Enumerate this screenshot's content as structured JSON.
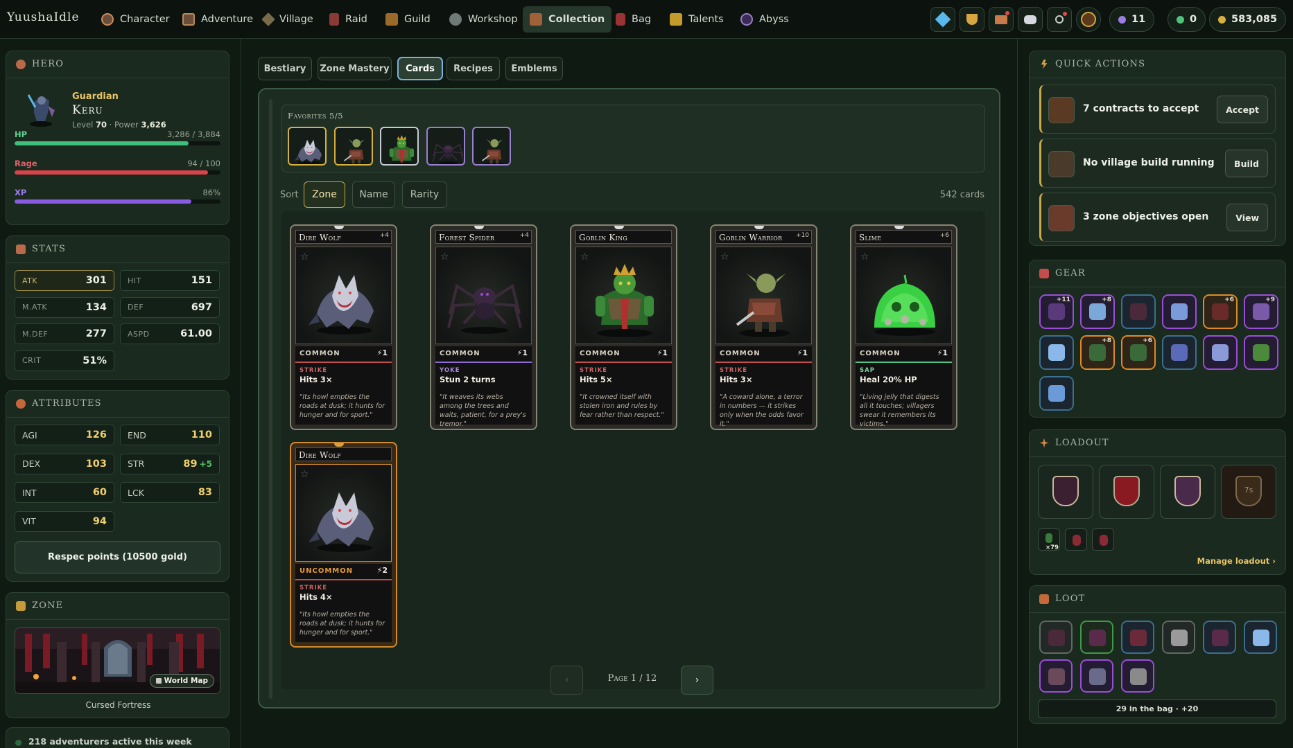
{
  "nav": {
    "logo": "YuushaIdle",
    "items": [
      {
        "label": "Character",
        "color": "#c98a5a"
      },
      {
        "label": "Adventure",
        "color": "#b9895a"
      },
      {
        "label": "Village",
        "color": "#a98f6a"
      },
      {
        "label": "Raid",
        "color": "#c76a5a"
      },
      {
        "label": "Guild",
        "color": "#c98a3a"
      },
      {
        "label": "Workshop",
        "color": "#9aa4a0"
      },
      {
        "label": "Collection",
        "color": "#c98a5a"
      },
      {
        "label": "Bag",
        "color": "#c74f4f"
      },
      {
        "label": "Talents",
        "color": "#d4a640"
      },
      {
        "label": "Abyss",
        "color": "#9a7fc0"
      }
    ],
    "active": "Collection",
    "counters": {
      "shards": "11",
      "gems": "0",
      "gold": "583,085"
    }
  },
  "hero": {
    "title": "Hero",
    "class_name": "Guardian",
    "name": "Keru",
    "level_label": "Level",
    "level": "70",
    "power_label": "Power",
    "power": "3,626",
    "bars": [
      {
        "label": "HP",
        "value": "3,286 / 3,884",
        "fraction": 0.846,
        "color": "#3fbf7a",
        "label_color": "#5fd490"
      },
      {
        "label": "Rage",
        "value": "94 / 100",
        "fraction": 0.94,
        "color": "#d9434a",
        "label_color": "#e4636a"
      },
      {
        "label": "XP",
        "value": "86%",
        "fraction": 0.86,
        "color": "#8a5ae0",
        "label_color": "#9f7bec"
      }
    ]
  },
  "stats": {
    "title": "Stats",
    "items": [
      {
        "k": "ATK",
        "v": "301"
      },
      {
        "k": "HIT",
        "v": "151"
      },
      {
        "k": "M.ATK",
        "v": "134"
      },
      {
        "k": "DEF",
        "v": "697"
      },
      {
        "k": "M.DEF",
        "v": "277"
      },
      {
        "k": "ASPD",
        "v": "61.00"
      },
      {
        "k": "CRIT",
        "v": "51%"
      }
    ]
  },
  "attributes": {
    "title": "Attributes",
    "items": [
      {
        "k": "AGI",
        "v": "126",
        "bonus": ""
      },
      {
        "k": "END",
        "v": "110",
        "bonus": ""
      },
      {
        "k": "DEX",
        "v": "103",
        "bonus": ""
      },
      {
        "k": "STR",
        "v": "89",
        "bonus": "+5"
      },
      {
        "k": "INT",
        "v": "60",
        "bonus": ""
      },
      {
        "k": "LCK",
        "v": "83",
        "bonus": ""
      },
      {
        "k": "VIT",
        "v": "94",
        "bonus": ""
      }
    ],
    "respec": "Respec points (10500 gold)"
  },
  "zone": {
    "title": "Zone",
    "map_button": "World Map",
    "name": "Cursed Fortress"
  },
  "activity": "218 adventurers active this week",
  "collection": {
    "tabs": [
      "Bestiary",
      "Zone Mastery",
      "Cards",
      "Recipes",
      "Emblems"
    ],
    "active_tab": "Cards",
    "favorites_label": "Favorites 5/5",
    "sort_label": "Sort",
    "sort_options": [
      "Zone",
      "Name",
      "Rarity"
    ],
    "active_sort": "Zone",
    "count": "542 cards",
    "page": "Page 1 / 12",
    "prev": "‹",
    "next": "›",
    "cards": [
      {
        "name": "Dire Wolf",
        "lvl": "+4",
        "rarity": "COMMON",
        "cost": "⚡1",
        "kw": "STRIKE",
        "kwcolor": "#c86464",
        "line": "#c44d4d",
        "effect": "Hits 3×",
        "flavor": "\"Its howl empties the roads at dusk; it hunts for hunger and for sport.\"",
        "art": "wolf"
      },
      {
        "name": "Forest Spider",
        "lvl": "+4",
        "rarity": "COMMON",
        "cost": "⚡1",
        "kw": "YOKE",
        "kwcolor": "#a88ad8",
        "line": "#8c6ad0",
        "effect": "Stun 2 turns",
        "flavor": "\"It weaves its webs among the trees and waits, patient, for a prey's tremor.\"",
        "art": "spider"
      },
      {
        "name": "Goblin King",
        "lvl": "",
        "rarity": "COMMON",
        "cost": "⚡1",
        "kw": "STRIKE",
        "kwcolor": "#c86464",
        "line": "#c44d4d",
        "effect": "Hits 5×",
        "flavor": "\"It crowned itself with stolen iron and rules by fear rather than respect.\"",
        "art": "king"
      },
      {
        "name": "Goblin Warrior",
        "lvl": "+10",
        "rarity": "COMMON",
        "cost": "⚡1",
        "kw": "STRIKE",
        "kwcolor": "#c86464",
        "line": "#c44d4d",
        "effect": "Hits 3×",
        "flavor": "\"A coward alone, a terror in numbers — it strikes only when the odds favor it.\"",
        "art": "warrior"
      },
      {
        "name": "Slime",
        "lvl": "+6",
        "rarity": "COMMON",
        "cost": "⚡1",
        "kw": "SAP",
        "kwcolor": "#7fd0a0",
        "line": "#4fc28a",
        "effect": "Heal 20% HP",
        "flavor": "\"Living jelly that digests all it touches; villagers swear it remembers its victims.\"",
        "art": "slime"
      },
      {
        "name": "Dire Wolf",
        "lvl": "",
        "rarity": "UNCOMMON",
        "cost": "⚡2",
        "kw": "STRIKE",
        "kwcolor": "#c86464",
        "line": "#c44d4d",
        "effect": "Hits 4×",
        "flavor": "\"Its howl empties the roads at dusk; it hunts for hunger and for sport.\"",
        "art": "wolf",
        "uncommon": true
      }
    ]
  },
  "quick_actions": {
    "title": "Quick Actions",
    "items": [
      {
        "text": "7 contracts to accept",
        "button": "Accept"
      },
      {
        "text": "No village build running",
        "button": "Build"
      },
      {
        "text": "3 zone objectives open",
        "button": "View"
      }
    ]
  },
  "gear": {
    "title": "Gear",
    "slots": [
      {
        "tier": "ep",
        "plus": "+11"
      },
      {
        "tier": "ep",
        "plus": "+8"
      },
      {
        "tier": "",
        "plus": ""
      },
      {
        "tier": "ep",
        "plus": ""
      },
      {
        "tier": "lg",
        "plus": "+6"
      },
      {
        "tier": "ep",
        "plus": "+9"
      },
      {
        "tier": "",
        "plus": ""
      },
      {
        "tier": "lg",
        "plus": "+8"
      },
      {
        "tier": "lg",
        "plus": "+6"
      },
      {
        "tier": "",
        "plus": ""
      },
      {
        "tier": "ep",
        "plus": ""
      },
      {
        "tier": "ep",
        "plus": ""
      },
      {
        "tier": "",
        "plus": ""
      }
    ]
  },
  "loadout": {
    "title": "Loadout",
    "cooldown": "7s",
    "consumable_count": "×79",
    "manage": "Manage loadout ›"
  },
  "loot": {
    "title": "Loot",
    "slots": [
      {
        "tier": "cm"
      },
      {
        "tier": "un"
      },
      {
        "tier": ""
      },
      {
        "tier": "cm"
      },
      {
        "tier": ""
      },
      {
        "tier": ""
      },
      {
        "tier": "ep"
      },
      {
        "tier": "ep"
      },
      {
        "tier": "ep"
      }
    ],
    "summary": "29 in the bag · +20"
  }
}
